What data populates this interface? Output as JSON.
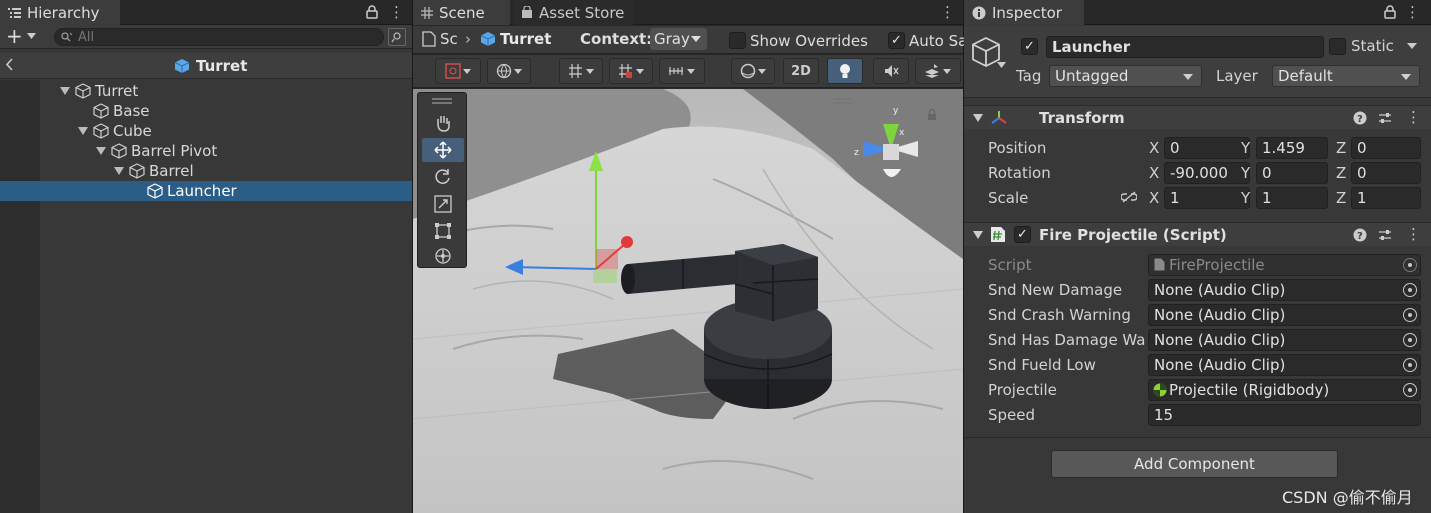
{
  "hierarchy": {
    "tab_label": "Hierarchy",
    "add_label": "+",
    "search_placeholder": "All",
    "breadcrumb": "Turret",
    "items": [
      {
        "label": "Turret"
      },
      {
        "label": "Base"
      },
      {
        "label": "Cube"
      },
      {
        "label": "Barrel Pivot"
      },
      {
        "label": "Barrel"
      },
      {
        "label": "Launcher"
      }
    ]
  },
  "scene": {
    "tabs": [
      {
        "label": "Scene"
      },
      {
        "label": "Asset Store"
      }
    ],
    "breadcrumb_root": "Sc",
    "breadcrumb_item": "Turret",
    "context_label": "Context:",
    "context_value": "Gray",
    "show_overrides": "Show Overrides",
    "auto_save": "Auto Sa",
    "btn_2d": "2D",
    "accent": "#46607c"
  },
  "inspector": {
    "tab_label": "Inspector",
    "object_name": "Launcher",
    "static_label": "Static",
    "tag_label": "Tag",
    "tag_value": "Untagged",
    "layer_label": "Layer",
    "layer_value": "Default",
    "transform": {
      "title": "Transform",
      "position_label": "Position",
      "rotation_label": "Rotation",
      "scale_label": "Scale",
      "axis_x": "X",
      "axis_y": "Y",
      "axis_z": "Z",
      "position": [
        "0",
        "1.459",
        "0"
      ],
      "rotation": [
        "-90.000",
        "0",
        "0"
      ],
      "scale": [
        "1",
        "1",
        "1"
      ]
    },
    "script_component": {
      "title": "Fire Projectile (Script)",
      "fields": [
        {
          "label": "Script",
          "value": "FireProjectile"
        },
        {
          "label": "Snd New Damage",
          "value": "None (Audio Clip)"
        },
        {
          "label": "Snd Crash Warning",
          "value": "None (Audio Clip)"
        },
        {
          "label": "Snd Has Damage Warn",
          "value": "None (Audio Clip)"
        },
        {
          "label": "Snd Fueld Low",
          "value": "None (Audio Clip)"
        },
        {
          "label": "Projectile",
          "value": "Projectile (Rigidbody)"
        },
        {
          "label": "Speed",
          "value": "15"
        }
      ]
    },
    "add_component": "Add Component",
    "watermark": "CSDN @偷不偷月"
  }
}
